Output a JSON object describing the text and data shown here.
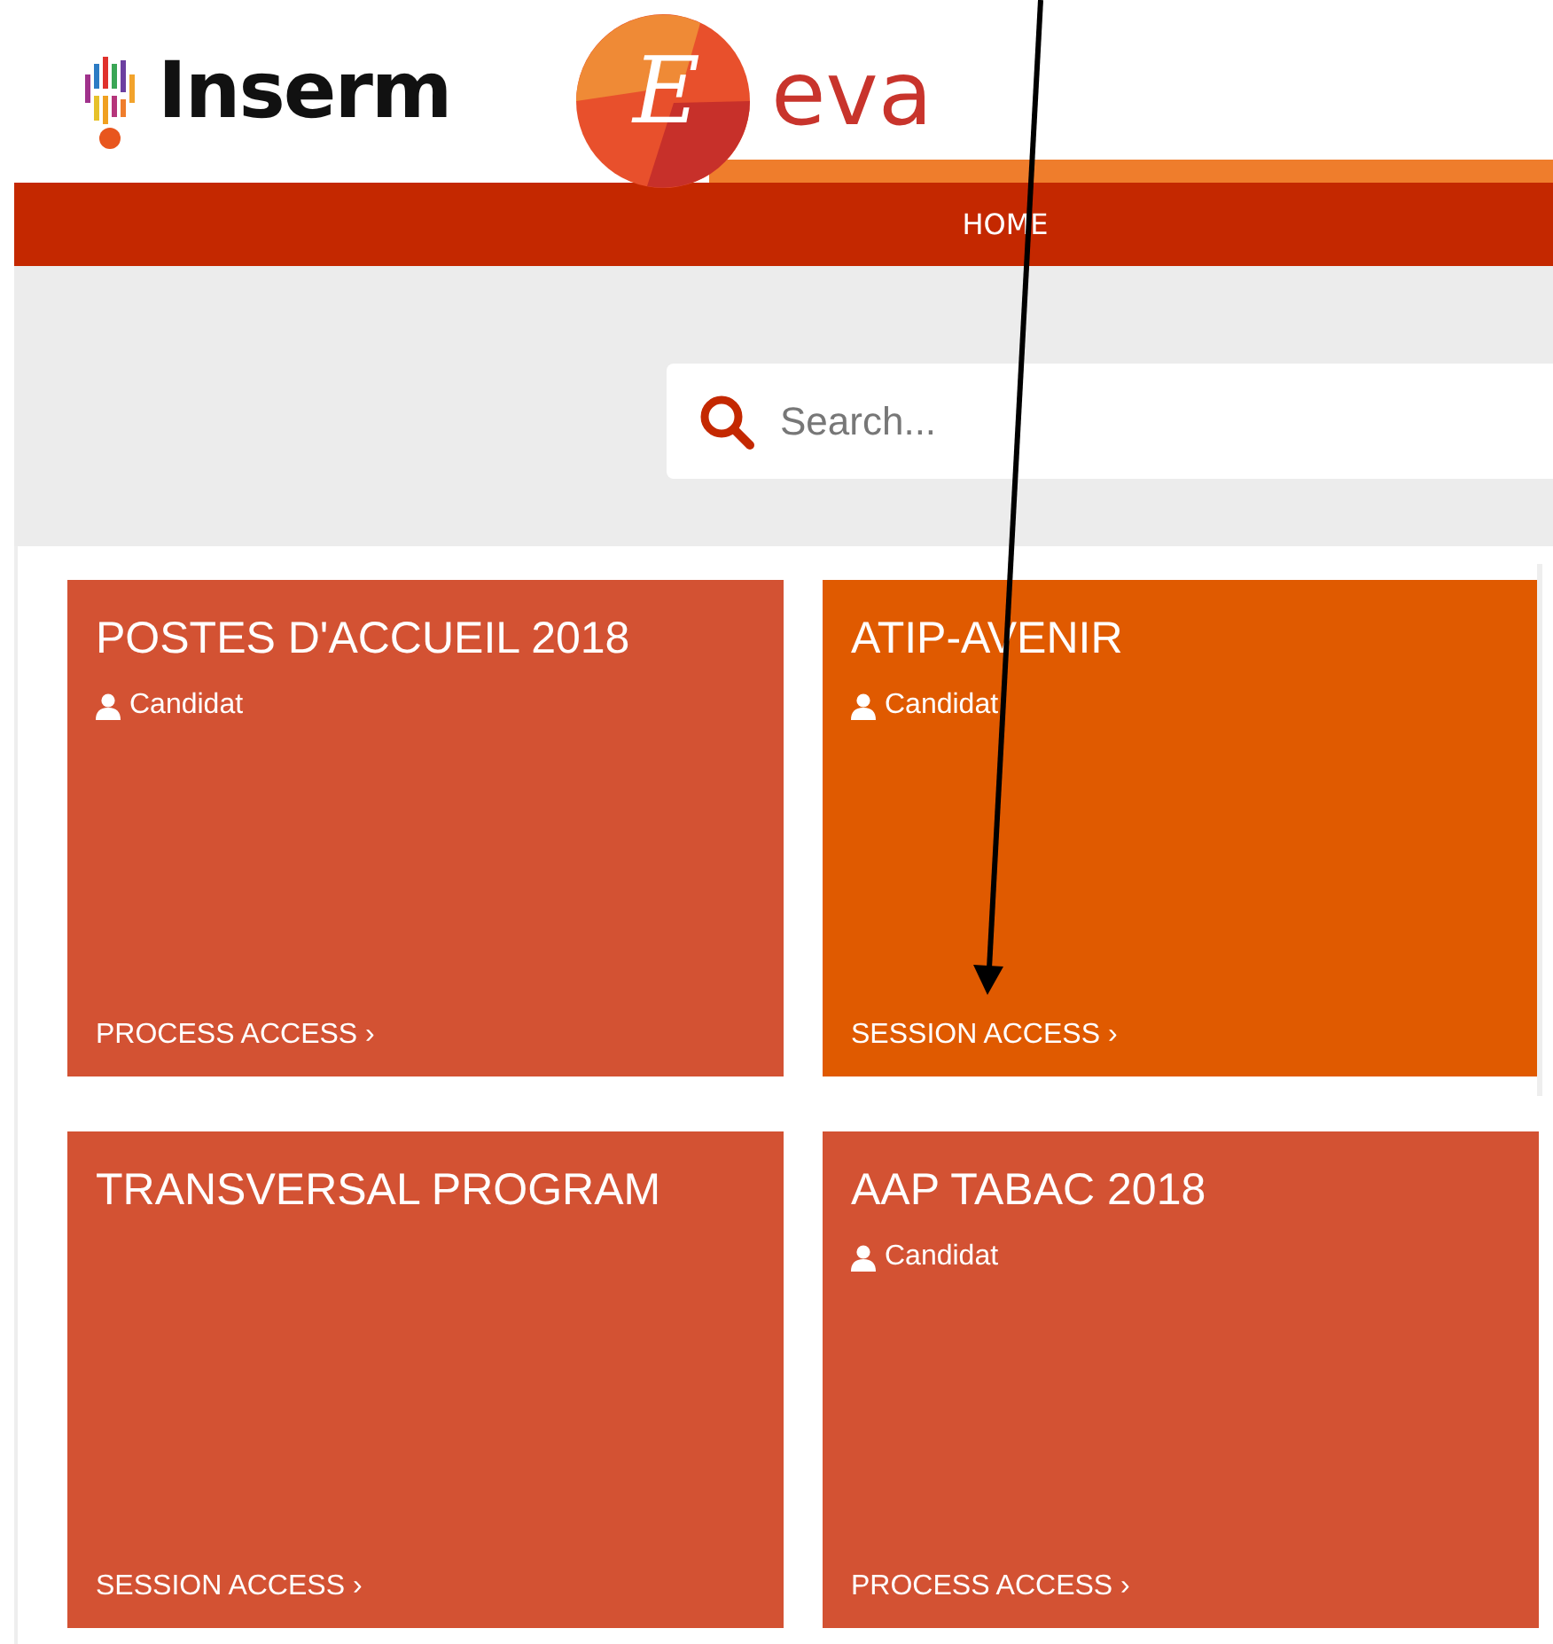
{
  "header": {
    "inserm_logo": "Inserm",
    "eva_badge_letter": "E",
    "eva_logo": "eva"
  },
  "nav": {
    "items": [
      {
        "label": "HOME",
        "selected": true
      }
    ]
  },
  "search": {
    "placeholder": "Search..."
  },
  "cards": [
    {
      "title": "POSTES D'ACCUEIL 2018",
      "role": "Candidat",
      "link": "PROCESS ACCESS",
      "chevron": "›",
      "color": "#d35233"
    },
    {
      "title": "ATIP-AVENIR",
      "role": "Candidat",
      "link": "SESSION ACCESS",
      "chevron": "›",
      "color": "#e05a00"
    },
    {
      "title": "TRANSVERSAL PROGRAM",
      "link": "SESSION ACCESS",
      "chevron": "›",
      "color": "#d35233"
    },
    {
      "title": "AAP TABAC 2018",
      "role": "Candidat",
      "link": "PROCESS ACCESS",
      "chevron": "›",
      "color": "#d35233"
    }
  ],
  "annotation": {
    "kind": "arrow"
  }
}
